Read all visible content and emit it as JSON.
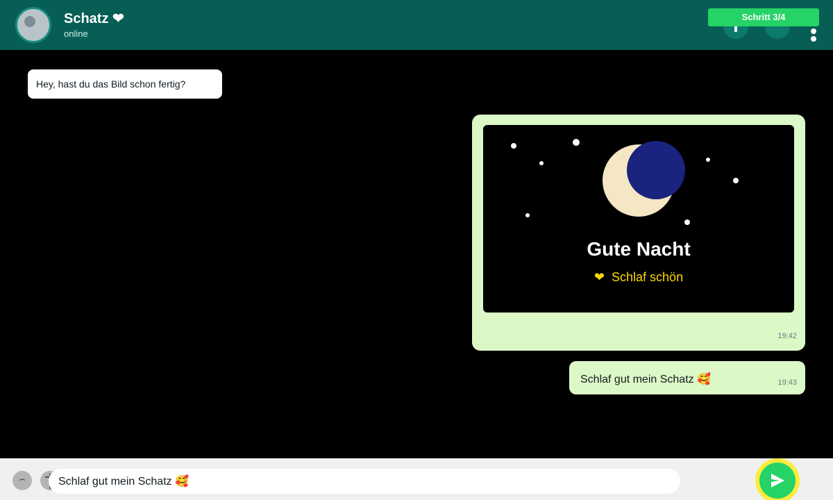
{
  "header": {
    "contact_name": "Schatz ❤",
    "status": "online",
    "step_badge": "Schritt 3/4",
    "icons": [
      "avatar",
      "video-call-icon",
      "voice-call-icon",
      "more-options-icon"
    ]
  },
  "messages": [
    {
      "direction": "incoming",
      "text": "Hey, hast du das Bild schon fertig?"
    },
    {
      "direction": "outgoing",
      "type": "image",
      "image": {
        "title": "Gute Nacht",
        "subtitle": "Schlaf schön",
        "subtitle_icon": "❤",
        "elements": [
          "moon",
          "stars"
        ]
      },
      "time": "19:42"
    },
    {
      "direction": "outgoing",
      "text": "Schlaf gut mein Schatz 🥰",
      "time": "19:43"
    }
  ],
  "composer": {
    "input_value": "Schlaf gut mein Schatz 🥰",
    "emoji_icon": "⌢",
    "send_icon": "send-icon"
  },
  "colors": {
    "header": "#075e54",
    "outgoing_bubble": "#dcf8c6",
    "incoming_bubble": "#ffffff",
    "accent": "#25d366",
    "highlight_ring": "#ffeb3b",
    "moon_shadow": "#1a237e"
  }
}
